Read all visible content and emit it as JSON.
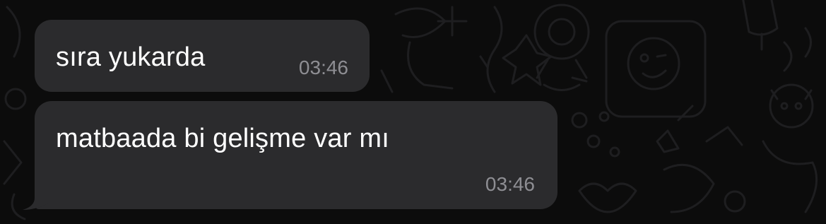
{
  "messages": [
    {
      "text": "sıra yukarda",
      "time": "03:46"
    },
    {
      "text": "matbaada bi gelişme var mı",
      "time": "03:46"
    }
  ],
  "colors": {
    "background": "#0c0c0c",
    "bubble": "#2b2b2d",
    "text": "#ffffff",
    "time": "#8e8e93",
    "doodle": "#1d1d1f"
  }
}
